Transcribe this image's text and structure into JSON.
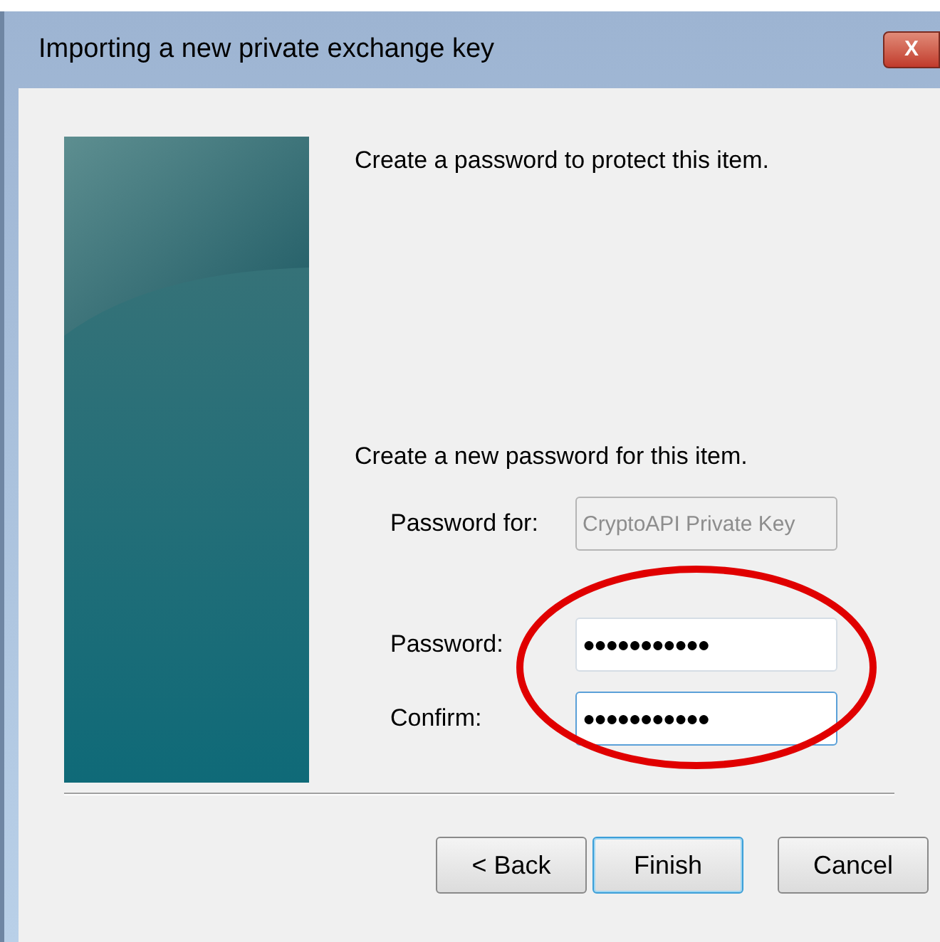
{
  "window": {
    "title": "Importing a new private exchange key",
    "close_button": "X"
  },
  "intro": "Create a password to protect this item.",
  "section": "Create a new password for this item.",
  "fields": [
    {
      "label": "Password for:",
      "value": "CryptoAPI Private Key",
      "disabled": true
    },
    {
      "label": "Password:",
      "value": "●●●●●●●●●●●",
      "disabled": false,
      "focused": false
    },
    {
      "label": "Confirm:",
      "value": "●●●●●●●●●●●",
      "disabled": false,
      "focused": true
    }
  ],
  "buttons": [
    {
      "label": "< Back",
      "default": false
    },
    {
      "label": "Finish",
      "default": true
    },
    {
      "label": "Cancel",
      "default": false
    }
  ]
}
